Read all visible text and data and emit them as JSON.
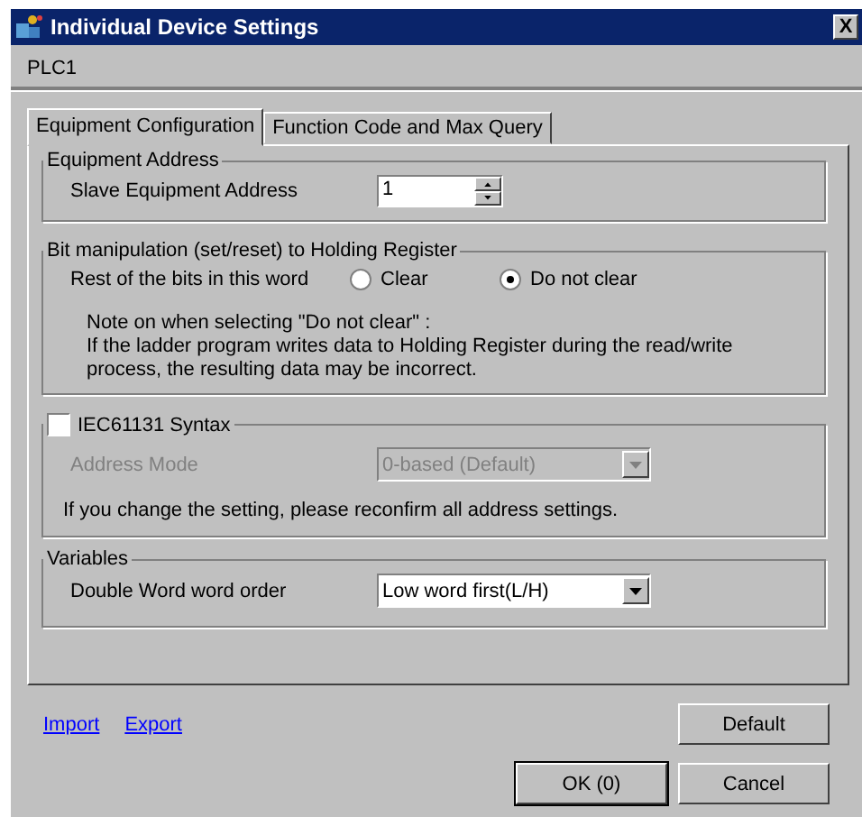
{
  "window": {
    "title": "Individual Device Settings",
    "close": "X"
  },
  "device": "PLC1",
  "tabs": [
    {
      "label": "Equipment Configuration",
      "selected": true
    },
    {
      "label": "Function Code and Max Query",
      "selected": false
    }
  ],
  "equipment_address": {
    "legend": "Equipment Address",
    "label": "Slave Equipment Address",
    "value": "1"
  },
  "bit_manipulation": {
    "legend": "Bit manipulation (set/reset) to Holding Register",
    "label": "Rest of the bits in this word",
    "options": [
      {
        "label": "Clear",
        "selected": false
      },
      {
        "label": "Do not clear",
        "selected": true
      }
    ],
    "note": [
      "Note on when selecting \"Do not clear\" :",
      "If the ladder program writes data to Holding Register during the read/write",
      "process, the resulting data may be incorrect."
    ]
  },
  "iec": {
    "legend": "IEC61131 Syntax",
    "checked": false,
    "label": "Address Mode",
    "value": "0-based (Default)",
    "disabled": true,
    "note": "If you change the setting, please reconfirm all address settings."
  },
  "variables": {
    "legend": "Variables",
    "label": "Double Word word order",
    "value": "Low word first(L/H)",
    "disabled": false
  },
  "links": [
    "Import",
    "Export"
  ],
  "buttons": {
    "default": "Default",
    "ok": "OK (0)",
    "cancel": "Cancel"
  }
}
